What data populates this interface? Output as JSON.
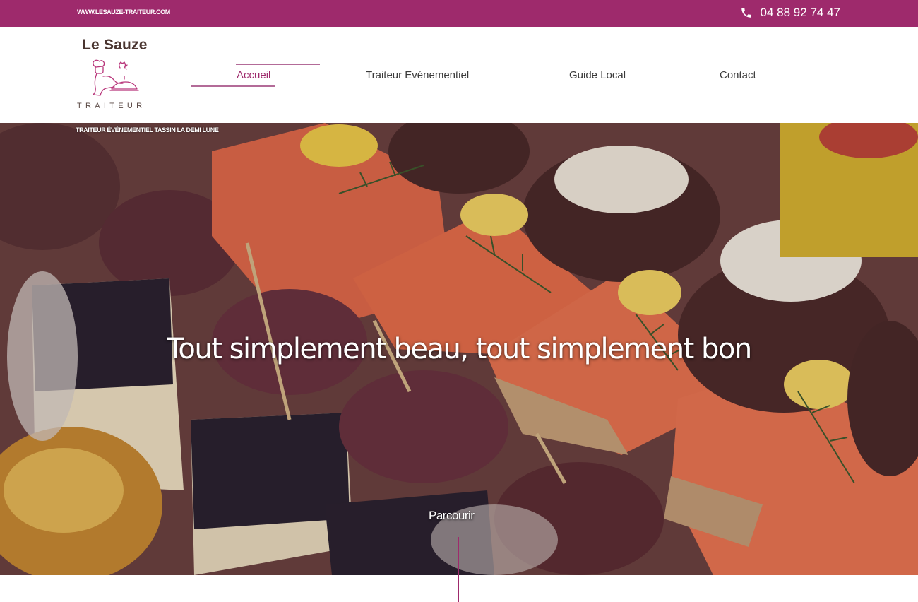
{
  "topbar": {
    "url": "WWW.LESAUZE-TRAITEUR.COM",
    "phone": "04 88 92 74 47",
    "phone_icon": "phone-icon"
  },
  "logo": {
    "brand": "Le Sauze",
    "subtitle": "TRAITEUR",
    "emblem": "chef-serving-dish-logo"
  },
  "nav": {
    "items": [
      {
        "label": "Accueil",
        "active": true
      },
      {
        "label": "Traiteur Evénementiel",
        "active": false
      },
      {
        "label": "Guide Local",
        "active": false
      },
      {
        "label": "Contact",
        "active": false
      }
    ]
  },
  "hero": {
    "breadcrumb": "TRAITEUR ÉVÉNEMENTIEL TASSIN LA DEMI LUNE",
    "headline": "Tout simplement beau, tout simplement bon",
    "browse_label": "Parcourir",
    "image": "canapés-platter-photo"
  },
  "colors": {
    "brand": "#9e2a6c",
    "nav_line": "#b36b98",
    "text": "#3a3a3a"
  }
}
